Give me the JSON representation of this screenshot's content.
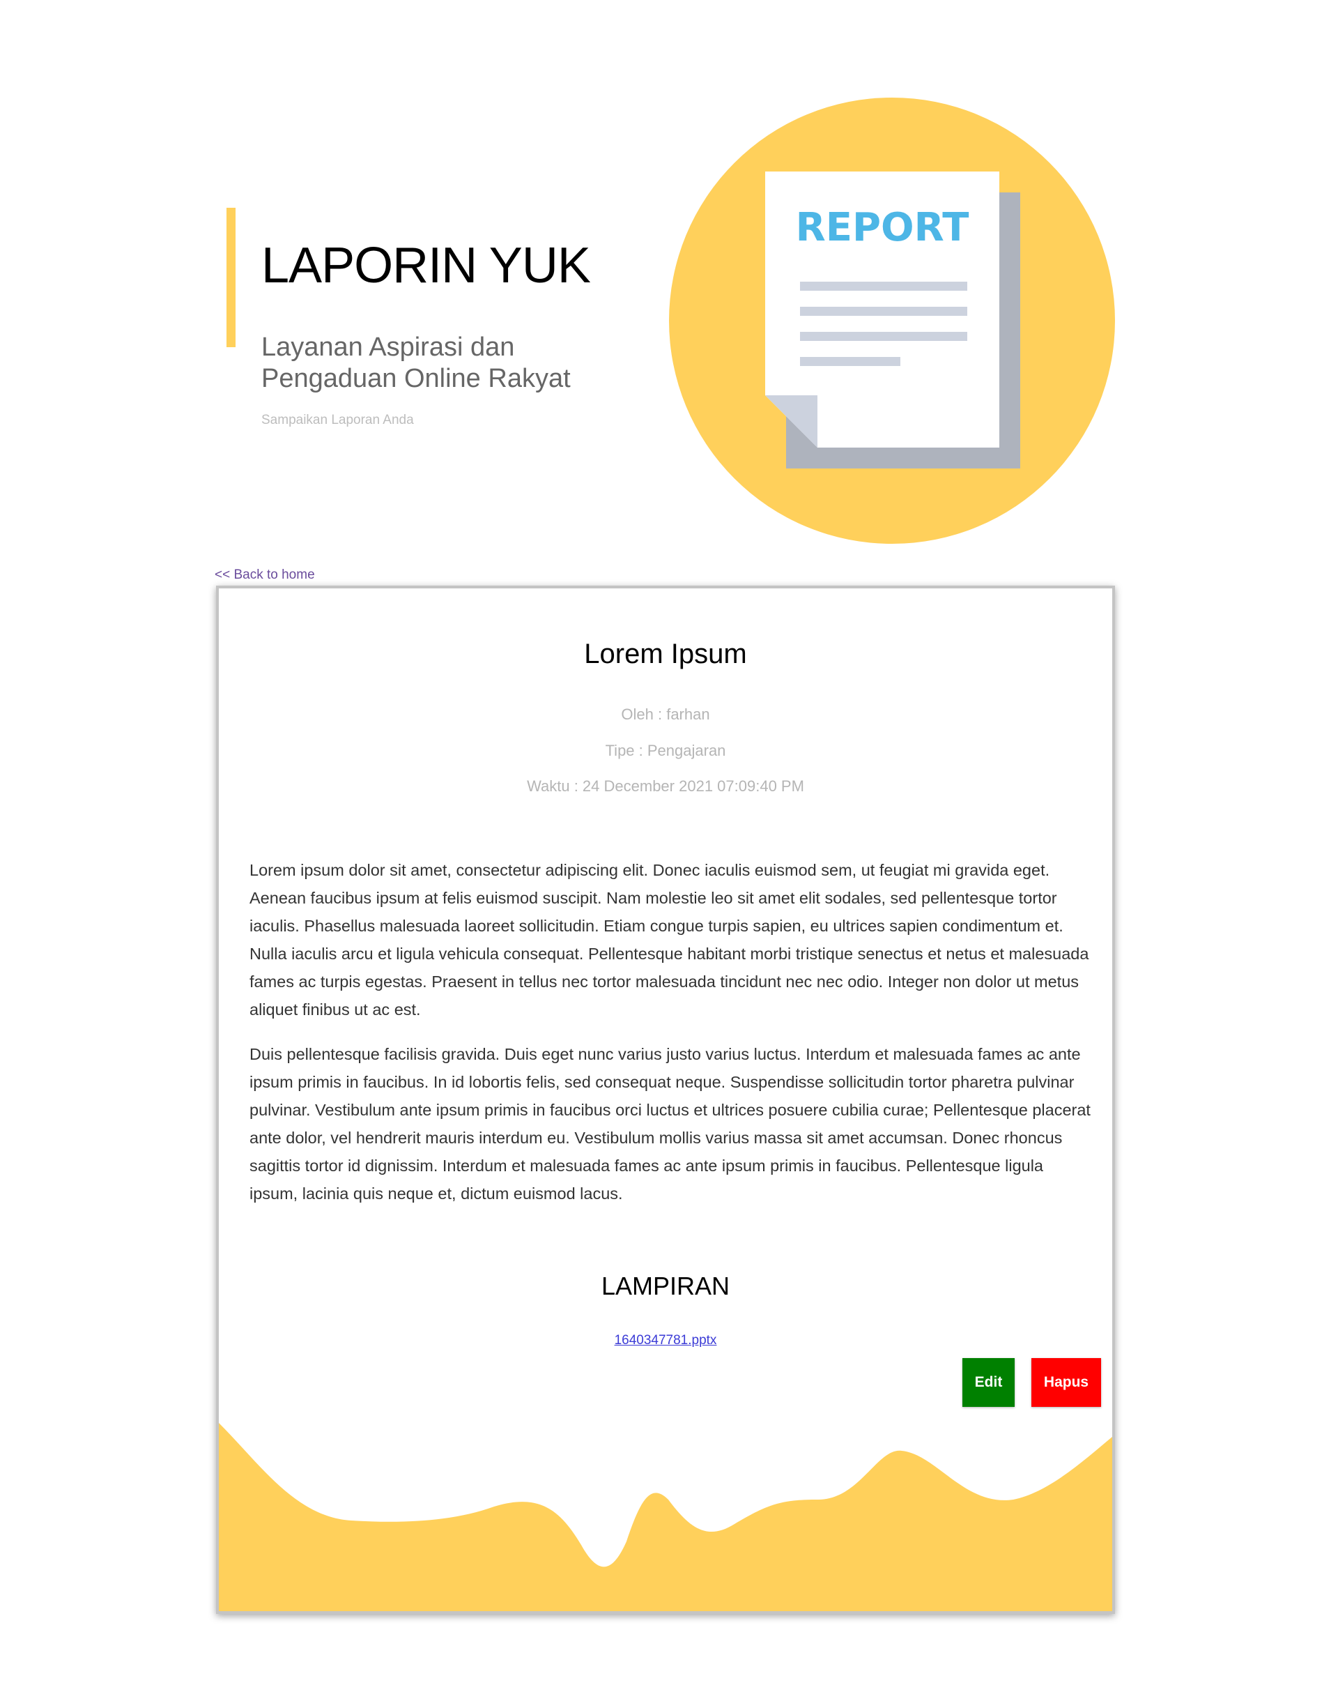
{
  "hero": {
    "title": "LAPORIN YUK",
    "subtitle": "Layanan Aspirasi dan Pengaduan Online Rakyat",
    "tagline": "Sampaikan Laporan Anda",
    "illustration_text": "REPORT",
    "illustration_icon": "report-document-icon"
  },
  "nav": {
    "back_label": "<< Back to home"
  },
  "report": {
    "title": "Lorem Ipsum",
    "author": "Oleh : farhan",
    "type": "Tipe : Pengajaran",
    "time": "Waktu : 24 December 2021 07:09:40 PM",
    "paragraphs": [
      "Lorem ipsum dolor sit amet, consectetur adipiscing elit. Donec iaculis euismod sem, ut feugiat mi gravida eget. Aenean faucibus ipsum at felis euismod suscipit. Nam molestie leo sit amet elit sodales, sed pellentesque tortor iaculis. Phasellus malesuada laoreet sollicitudin. Etiam congue turpis sapien, eu ultrices sapien condimentum et. Nulla iaculis arcu et ligula vehicula consequat. Pellentesque habitant morbi tristique senectus et netus et malesuada fames ac turpis egestas. Praesent in tellus nec tortor malesuada tincidunt nec nec odio. Integer non dolor ut metus aliquet finibus ut ac est.",
      "Duis pellentesque facilisis gravida. Duis eget nunc varius justo varius luctus. Interdum et malesuada fames ac ante ipsum primis in faucibus. In id lobortis felis, sed consequat neque. Suspendisse sollicitudin tortor pharetra pulvinar pulvinar. Vestibulum ante ipsum primis in faucibus orci luctus et ultrices posuere cubilia curae; Pellentesque placerat ante dolor, vel hendrerit mauris interdum eu. Vestibulum mollis varius massa sit amet accumsan. Donec rhoncus sagittis tortor id dignissim. Interdum et malesuada fames ac ante ipsum primis in faucibus. Pellentesque ligula ipsum, lacinia quis neque et, dictum euismod lacus."
    ],
    "attachment_heading": "LAMPIRAN",
    "attachment_file": "1640347781.pptx",
    "edit_label": "Edit",
    "delete_label": "Hapus"
  },
  "colors": {
    "accent_yellow": "#ffd05b",
    "edit_green": "#008000",
    "delete_red": "#ff0000",
    "report_blue": "#4db6e6",
    "link_blue": "#3b3bd6",
    "back_link_purple": "#6a4c9c"
  }
}
